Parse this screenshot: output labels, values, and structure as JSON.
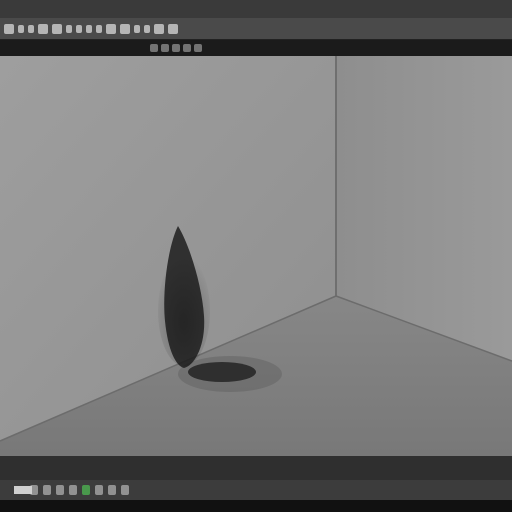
{
  "app": {
    "title": ""
  },
  "toolbar": {
    "icon_names": [
      "file-icon",
      "open-icon",
      "save-icon",
      "undo-icon",
      "redo-icon",
      "select-icon",
      "move-icon",
      "rotate-icon",
      "scale-icon",
      "render-icon",
      "camera-icon",
      "light-icon",
      "material-icon",
      "grid-icon",
      "settings-icon"
    ]
  },
  "viewport": {
    "description": "",
    "colors": {
      "back_wall": "#9a9a9a",
      "right_wall": "#8b8b8b",
      "floor": "#7e7e7e",
      "shadow": "#1a1a1a"
    }
  },
  "bottom_toolbar": {
    "icon_names": [
      "play-icon",
      "stop-icon",
      "frame-back-icon",
      "frame-forward-icon",
      "keyframe-icon",
      "timeline-icon",
      "loop-icon",
      "render-preview-icon"
    ]
  }
}
